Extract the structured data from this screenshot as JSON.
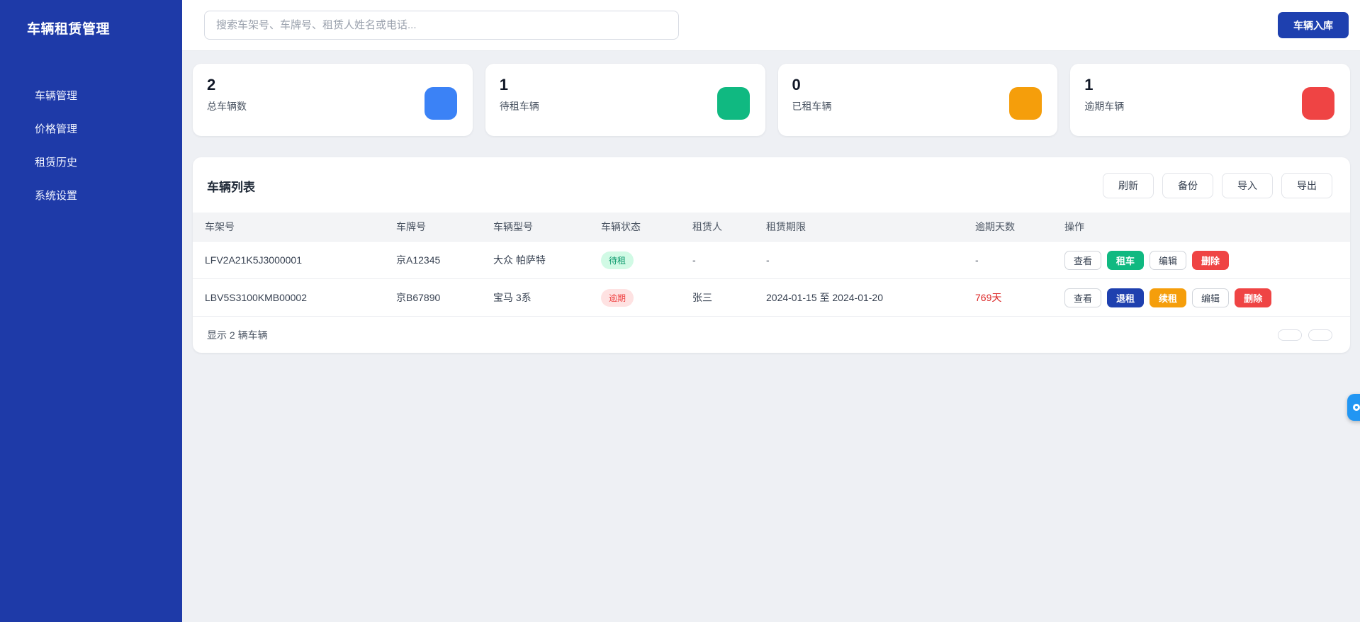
{
  "app": {
    "title": "车辆租赁管理"
  },
  "sidebar": {
    "items": [
      {
        "label": "车辆管理"
      },
      {
        "label": "价格管理"
      },
      {
        "label": "租赁历史"
      },
      {
        "label": "系统设置"
      }
    ]
  },
  "topbar": {
    "search_placeholder": "搜索车架号、车牌号、租赁人姓名或电话...",
    "add_button_label": "车辆入库"
  },
  "stats": [
    {
      "value": "2",
      "label": "总车辆数",
      "color": "#3b82f6",
      "icon": "total-vehicles-icon"
    },
    {
      "value": "1",
      "label": "待租车辆",
      "color": "#10b981",
      "icon": "available-vehicles-icon"
    },
    {
      "value": "0",
      "label": "已租车辆",
      "color": "#f59e0b",
      "icon": "rented-vehicles-icon"
    },
    {
      "value": "1",
      "label": "逾期车辆",
      "color": "#ef4444",
      "icon": "overdue-vehicles-icon"
    }
  ],
  "list": {
    "title": "车辆列表",
    "toolbar": {
      "refresh": "刷新",
      "backup": "备份",
      "import": "导入",
      "export": "导出"
    },
    "columns": [
      "车架号",
      "车牌号",
      "车辆型号",
      "车辆状态",
      "租赁人",
      "租赁期限",
      "逾期天数",
      "操作"
    ],
    "rows": [
      {
        "vin": "LFV2A21K5J3000001",
        "plate": "京A12345",
        "model": "大众 帕萨特",
        "status": "待租",
        "renter": "-",
        "period": "-",
        "overdue_days": "-",
        "actions": [
          {
            "label": "查看"
          },
          {
            "label": "租车"
          },
          {
            "label": "编辑"
          },
          {
            "label": "删除"
          }
        ]
      },
      {
        "vin": "LBV5S3100KMB00002",
        "plate": "京B67890",
        "model": "宝马 3系",
        "status": "逾期",
        "renter": "张三",
        "period": "2024-01-15 至 2024-01-20",
        "overdue_days": "769天",
        "actions": [
          {
            "label": "查看"
          },
          {
            "label": "退租"
          },
          {
            "label": "续租"
          },
          {
            "label": "编辑"
          },
          {
            "label": "删除"
          }
        ]
      }
    ],
    "footer_text": "显示 2 辆车辆"
  }
}
